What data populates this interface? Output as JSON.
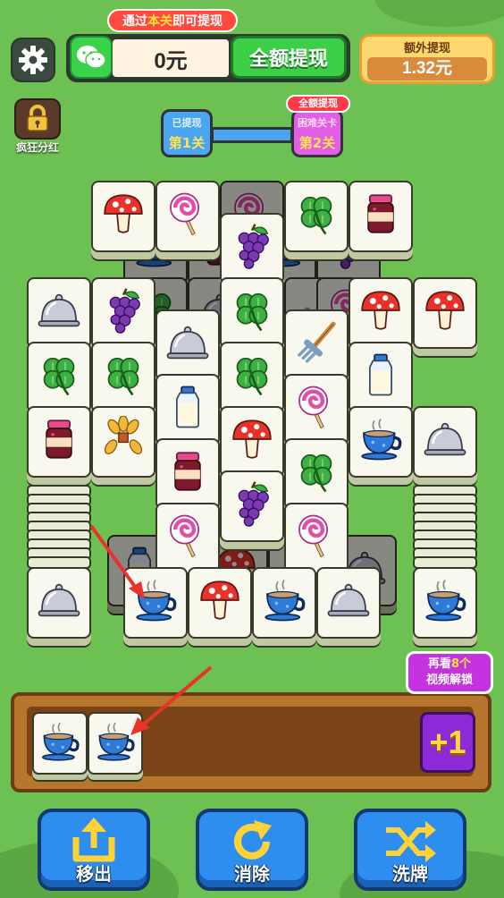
{
  "header": {
    "hint_prefix": "通过",
    "hint_highlight": "本关",
    "hint_suffix": "即可提现",
    "balance": "0元",
    "withdraw_all": "全额提现",
    "extra_label": "额外提现",
    "extra_value": "1.32元"
  },
  "sidebar": {
    "chest_label": "疯狂分红"
  },
  "progress": {
    "done_label": "已提现",
    "level1": "第1关",
    "hard_tag": "全额提现",
    "hard_label": "困难关卡",
    "level2": "第2关"
  },
  "board": {
    "tiles": [
      {
        "icon": "mushroom"
      },
      {
        "icon": "lollipop"
      },
      {
        "icon": "clover"
      },
      {
        "icon": "jam"
      },
      {
        "icon": "grapes"
      },
      {
        "icon": "cloche"
      },
      {
        "icon": "grapes"
      },
      {
        "icon": "clover"
      },
      {
        "icon": "mushroom"
      },
      {
        "icon": "mushroom"
      },
      {
        "icon": "cloche"
      },
      {
        "icon": "rake"
      },
      {
        "icon": "clover"
      },
      {
        "icon": "clover"
      },
      {
        "icon": "milk"
      },
      {
        "icon": "clover"
      },
      {
        "icon": "lollipop"
      },
      {
        "icon": "milk"
      },
      {
        "icon": "jam"
      },
      {
        "icon": "wheat"
      },
      {
        "icon": "mushroom"
      },
      {
        "icon": "teacup"
      },
      {
        "icon": "cloche"
      },
      {
        "icon": "jam"
      },
      {
        "icon": "clover"
      },
      {
        "icon": "grapes"
      },
      {
        "icon": "lollipop"
      },
      {
        "icon": "lollipop"
      },
      {
        "icon": "cloche"
      },
      {
        "icon": "teacup"
      },
      {
        "icon": "mushroom"
      },
      {
        "icon": "teacup"
      },
      {
        "icon": "cloche"
      },
      {
        "icon": "teacup"
      }
    ]
  },
  "tray": {
    "slots": [
      {
        "icon": "teacup"
      },
      {
        "icon": "teacup"
      }
    ],
    "unlock_prefix": "再看",
    "unlock_count": "8个",
    "unlock_suffix": "视频解锁",
    "add_slot_label": "+1"
  },
  "actions": {
    "move_out": "移出",
    "eliminate": "消除",
    "shuffle": "洗牌"
  },
  "colors": {
    "grass": "#6dc152",
    "tray_wood": "#b8752c",
    "button_blue": "#2e8ef0",
    "accent_red": "#ff4a3d",
    "accent_purple": "#8b2ad6"
  }
}
